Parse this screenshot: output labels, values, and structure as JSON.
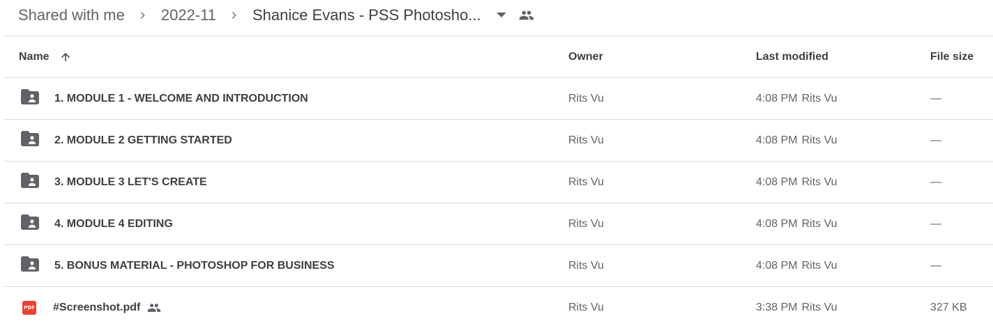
{
  "breadcrumb": {
    "items": [
      "Shared with me",
      "2022-11",
      "Shanice Evans - PSS Photosho..."
    ]
  },
  "table": {
    "headers": {
      "name": "Name",
      "owner": "Owner",
      "last_modified": "Last modified",
      "file_size": "File size"
    },
    "rows": [
      {
        "name": "1. MODULE 1 - WELCOME AND INTRODUCTION",
        "owner": "Rits Vu",
        "modified_time": "4:08 PM",
        "modified_by": "Rits Vu",
        "size": "—",
        "type": "shared-folder-icon"
      },
      {
        "name": "2. MODULE 2 GETTING STARTED",
        "owner": "Rits Vu",
        "modified_time": "4:08 PM",
        "modified_by": "Rits Vu",
        "size": "—",
        "type": "shared-folder-icon"
      },
      {
        "name": "3. MODULE 3 LET'S CREATE",
        "owner": "Rits Vu",
        "modified_time": "4:08 PM",
        "modified_by": "Rits Vu",
        "size": "—",
        "type": "shared-folder-icon"
      },
      {
        "name": "4. MODULE 4 EDITING",
        "owner": "Rits Vu",
        "modified_time": "4:08 PM",
        "modified_by": "Rits Vu",
        "size": "—",
        "type": "shared-folder-icon"
      },
      {
        "name": "5. BONUS MATERIAL - PHOTOSHOP FOR BUSINESS",
        "owner": "Rits Vu",
        "modified_time": "4:08 PM",
        "modified_by": "Rits Vu",
        "size": "—",
        "type": "shared-folder-icon"
      },
      {
        "name": "#Screenshot.pdf",
        "owner": "Rits Vu",
        "modified_time": "3:38 PM",
        "modified_by": "Rits Vu",
        "size": "327 KB",
        "type": "pdf-icon",
        "pdf_badge": "PDF"
      }
    ]
  },
  "colors": {
    "text_primary": "#3c4043",
    "text_secondary": "#5f6368",
    "divider": "#dadce0",
    "pdf_red": "#ea4335"
  }
}
